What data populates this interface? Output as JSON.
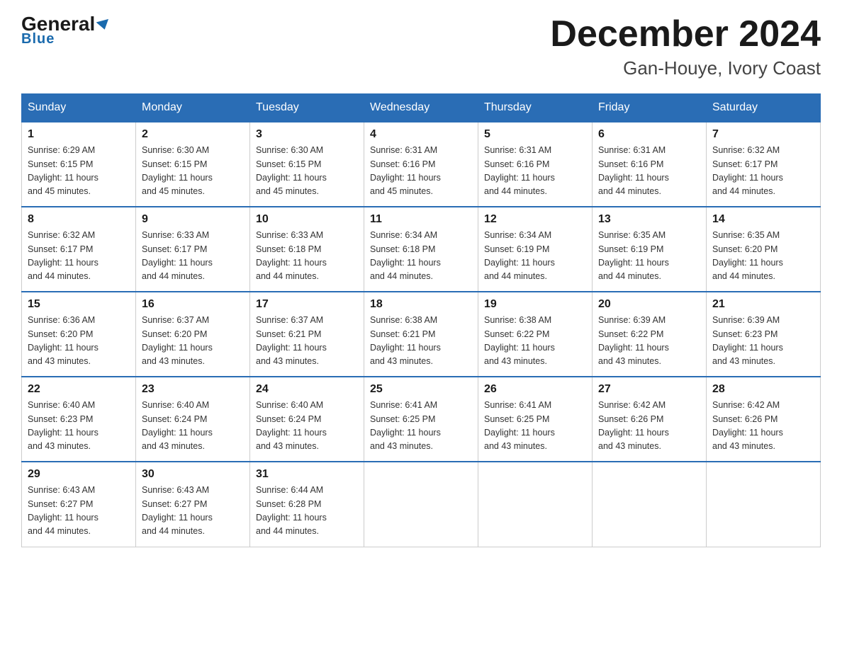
{
  "logo": {
    "name": "General",
    "name2": "Blue"
  },
  "header": {
    "month": "December 2024",
    "location": "Gan-Houye, Ivory Coast"
  },
  "days_of_week": [
    "Sunday",
    "Monday",
    "Tuesday",
    "Wednesday",
    "Thursday",
    "Friday",
    "Saturday"
  ],
  "weeks": [
    [
      {
        "day": "1",
        "sunrise": "6:29 AM",
        "sunset": "6:15 PM",
        "daylight": "11 hours and 45 minutes."
      },
      {
        "day": "2",
        "sunrise": "6:30 AM",
        "sunset": "6:15 PM",
        "daylight": "11 hours and 45 minutes."
      },
      {
        "day": "3",
        "sunrise": "6:30 AM",
        "sunset": "6:15 PM",
        "daylight": "11 hours and 45 minutes."
      },
      {
        "day": "4",
        "sunrise": "6:31 AM",
        "sunset": "6:16 PM",
        "daylight": "11 hours and 45 minutes."
      },
      {
        "day": "5",
        "sunrise": "6:31 AM",
        "sunset": "6:16 PM",
        "daylight": "11 hours and 44 minutes."
      },
      {
        "day": "6",
        "sunrise": "6:31 AM",
        "sunset": "6:16 PM",
        "daylight": "11 hours and 44 minutes."
      },
      {
        "day": "7",
        "sunrise": "6:32 AM",
        "sunset": "6:17 PM",
        "daylight": "11 hours and 44 minutes."
      }
    ],
    [
      {
        "day": "8",
        "sunrise": "6:32 AM",
        "sunset": "6:17 PM",
        "daylight": "11 hours and 44 minutes."
      },
      {
        "day": "9",
        "sunrise": "6:33 AM",
        "sunset": "6:17 PM",
        "daylight": "11 hours and 44 minutes."
      },
      {
        "day": "10",
        "sunrise": "6:33 AM",
        "sunset": "6:18 PM",
        "daylight": "11 hours and 44 minutes."
      },
      {
        "day": "11",
        "sunrise": "6:34 AM",
        "sunset": "6:18 PM",
        "daylight": "11 hours and 44 minutes."
      },
      {
        "day": "12",
        "sunrise": "6:34 AM",
        "sunset": "6:19 PM",
        "daylight": "11 hours and 44 minutes."
      },
      {
        "day": "13",
        "sunrise": "6:35 AM",
        "sunset": "6:19 PM",
        "daylight": "11 hours and 44 minutes."
      },
      {
        "day": "14",
        "sunrise": "6:35 AM",
        "sunset": "6:20 PM",
        "daylight": "11 hours and 44 minutes."
      }
    ],
    [
      {
        "day": "15",
        "sunrise": "6:36 AM",
        "sunset": "6:20 PM",
        "daylight": "11 hours and 43 minutes."
      },
      {
        "day": "16",
        "sunrise": "6:37 AM",
        "sunset": "6:20 PM",
        "daylight": "11 hours and 43 minutes."
      },
      {
        "day": "17",
        "sunrise": "6:37 AM",
        "sunset": "6:21 PM",
        "daylight": "11 hours and 43 minutes."
      },
      {
        "day": "18",
        "sunrise": "6:38 AM",
        "sunset": "6:21 PM",
        "daylight": "11 hours and 43 minutes."
      },
      {
        "day": "19",
        "sunrise": "6:38 AM",
        "sunset": "6:22 PM",
        "daylight": "11 hours and 43 minutes."
      },
      {
        "day": "20",
        "sunrise": "6:39 AM",
        "sunset": "6:22 PM",
        "daylight": "11 hours and 43 minutes."
      },
      {
        "day": "21",
        "sunrise": "6:39 AM",
        "sunset": "6:23 PM",
        "daylight": "11 hours and 43 minutes."
      }
    ],
    [
      {
        "day": "22",
        "sunrise": "6:40 AM",
        "sunset": "6:23 PM",
        "daylight": "11 hours and 43 minutes."
      },
      {
        "day": "23",
        "sunrise": "6:40 AM",
        "sunset": "6:24 PM",
        "daylight": "11 hours and 43 minutes."
      },
      {
        "day": "24",
        "sunrise": "6:40 AM",
        "sunset": "6:24 PM",
        "daylight": "11 hours and 43 minutes."
      },
      {
        "day": "25",
        "sunrise": "6:41 AM",
        "sunset": "6:25 PM",
        "daylight": "11 hours and 43 minutes."
      },
      {
        "day": "26",
        "sunrise": "6:41 AM",
        "sunset": "6:25 PM",
        "daylight": "11 hours and 43 minutes."
      },
      {
        "day": "27",
        "sunrise": "6:42 AM",
        "sunset": "6:26 PM",
        "daylight": "11 hours and 43 minutes."
      },
      {
        "day": "28",
        "sunrise": "6:42 AM",
        "sunset": "6:26 PM",
        "daylight": "11 hours and 43 minutes."
      }
    ],
    [
      {
        "day": "29",
        "sunrise": "6:43 AM",
        "sunset": "6:27 PM",
        "daylight": "11 hours and 44 minutes."
      },
      {
        "day": "30",
        "sunrise": "6:43 AM",
        "sunset": "6:27 PM",
        "daylight": "11 hours and 44 minutes."
      },
      {
        "day": "31",
        "sunrise": "6:44 AM",
        "sunset": "6:28 PM",
        "daylight": "11 hours and 44 minutes."
      },
      null,
      null,
      null,
      null
    ]
  ],
  "labels": {
    "sunrise": "Sunrise:",
    "sunset": "Sunset:",
    "daylight": "Daylight:"
  }
}
